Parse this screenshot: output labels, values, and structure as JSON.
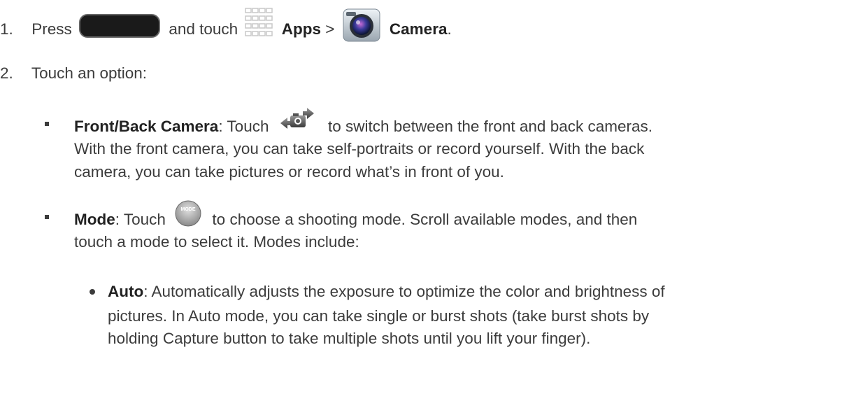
{
  "step1": {
    "number": "1.",
    "press": "Press",
    "and_touch": "and touch",
    "apps": "Apps",
    "sep": ">",
    "camera": "Camera",
    "end": "."
  },
  "step2": {
    "number": "2.",
    "text": "Touch an option:"
  },
  "front_back": {
    "label": "Front/Back Camera",
    "pre": ": Touch",
    "line1_rest": "to switch between the front and back cameras.",
    "line2": "With the front camera, you can take self-portraits or record yourself. With the back",
    "line3": "camera, you can take pictures or record what’s in front of you."
  },
  "mode": {
    "label": "Mode",
    "pre": ": Touch",
    "line1_rest": "to choose a shooting mode. Scroll available modes, and then",
    "line2": "touch a mode to select it. Modes include:",
    "icon_text": "MODE"
  },
  "auto": {
    "label": "Auto",
    "line1_rest": ": Automatically adjusts the exposure to optimize the color and brightness of",
    "line2": "pictures. In Auto mode, you can take single or burst shots (take burst shots by",
    "line3": "holding Capture button to take multiple shots until you lift your finger)."
  },
  "icons": [
    "home-key-icon",
    "apps-grid-icon",
    "camera-app-icon",
    "switch-camera-icon",
    "mode-icon"
  ]
}
